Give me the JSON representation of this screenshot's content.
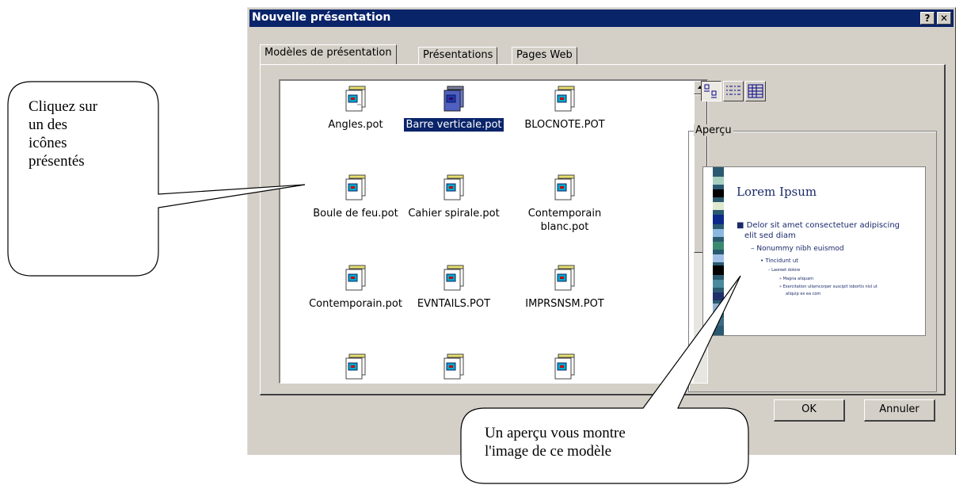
{
  "dialog": {
    "title": "Nouvelle présentation",
    "help_label": "?",
    "close_label": "✕",
    "tabs": [
      {
        "label": "Modèles de présentation",
        "active": true
      },
      {
        "label": "Présentations",
        "active": false
      },
      {
        "label": "Pages Web",
        "active": false
      }
    ],
    "templates": [
      {
        "name": "Angles.pot",
        "selected": false
      },
      {
        "name": "Barre verticale.pot",
        "selected": true
      },
      {
        "name": "BLOCNOTE.POT",
        "selected": false
      },
      {
        "name": "Boule de feu.pot",
        "selected": false
      },
      {
        "name": "Cahier spirale.pot",
        "selected": false
      },
      {
        "name": "Contemporain blanc.pot",
        "selected": false
      },
      {
        "name": "Contemporain.pot",
        "selected": false
      },
      {
        "name": "EVNTAILS.POT",
        "selected": false
      },
      {
        "name": "IMPRSNSM.POT",
        "selected": false
      }
    ],
    "view_buttons": [
      "large-icons",
      "list",
      "details"
    ],
    "preview_group_label": "Aperçu",
    "preview": {
      "title": "Lorem Ipsum",
      "lines": [
        "■ Delor sit amet consectetuer adipiscing",
        "elit sed diam",
        "– Nonummy nibh euismod",
        "• Tincidunt ut",
        "– Laoreet dolore",
        "» Magna aliquam",
        "» Exercitation ullamcorper suscipit lobortis nisl ut",
        "aliquip ex ea com"
      ]
    },
    "ok_label": "OK",
    "cancel_label": "Annuler",
    "colors": {
      "titlebar": "#0a246a",
      "face": "#d4d0c8"
    }
  },
  "callouts": {
    "left": [
      "Cliquez sur",
      "un des",
      "icônes",
      "présentés"
    ],
    "bottom": [
      "Un aperçu vous montre",
      "l'image de ce modèle"
    ]
  }
}
